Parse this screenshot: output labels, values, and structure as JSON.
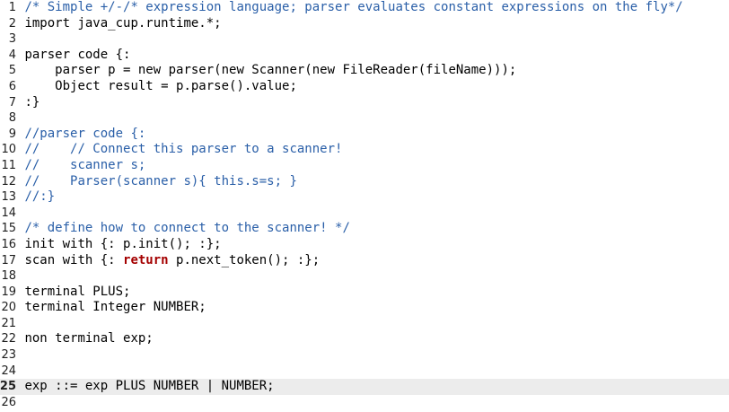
{
  "editor": {
    "current_line": 25,
    "colors": {
      "comment": "#2a5fa8",
      "keyword": "#a40000",
      "current_line_bg": "#ececec"
    },
    "lines": [
      {
        "num": "1",
        "segments": [
          {
            "t": "/* Simple +/-/* expression language; parser evaluates constant expressions on the fly*/",
            "c": "comment"
          }
        ]
      },
      {
        "num": "2",
        "segments": [
          {
            "t": "import java_cup.runtime.*;",
            "c": "plain"
          }
        ]
      },
      {
        "num": "3",
        "segments": []
      },
      {
        "num": "4",
        "segments": [
          {
            "t": "parser code {:",
            "c": "plain"
          }
        ]
      },
      {
        "num": "5",
        "segments": [
          {
            "t": "    parser p = new parser(new Scanner(new FileReader(fileName)));",
            "c": "plain"
          }
        ]
      },
      {
        "num": "6",
        "segments": [
          {
            "t": "    Object result = p.parse().value;",
            "c": "plain"
          }
        ]
      },
      {
        "num": "7",
        "segments": [
          {
            "t": ":}",
            "c": "plain"
          }
        ]
      },
      {
        "num": "8",
        "segments": []
      },
      {
        "num": "9",
        "segments": [
          {
            "t": "//parser code {:",
            "c": "comment"
          }
        ]
      },
      {
        "num": "10",
        "segments": [
          {
            "t": "//    // Connect this parser to a scanner!",
            "c": "comment"
          }
        ]
      },
      {
        "num": "11",
        "segments": [
          {
            "t": "//    scanner s;",
            "c": "comment"
          }
        ]
      },
      {
        "num": "12",
        "segments": [
          {
            "t": "//    Parser(scanner s){ this.s=s; }",
            "c": "comment"
          }
        ]
      },
      {
        "num": "13",
        "segments": [
          {
            "t": "//:}",
            "c": "comment"
          }
        ]
      },
      {
        "num": "14",
        "segments": []
      },
      {
        "num": "15",
        "segments": [
          {
            "t": "/* define how to connect to the scanner! */",
            "c": "comment"
          }
        ]
      },
      {
        "num": "16",
        "segments": [
          {
            "t": "init with {: p.init(); :};",
            "c": "plain"
          }
        ]
      },
      {
        "num": "17",
        "segments": [
          {
            "t": "scan with {: ",
            "c": "plain"
          },
          {
            "t": "return",
            "c": "keyword"
          },
          {
            "t": " p.next_token(); :};",
            "c": "plain"
          }
        ]
      },
      {
        "num": "18",
        "segments": []
      },
      {
        "num": "19",
        "segments": [
          {
            "t": "terminal PLUS;",
            "c": "plain"
          }
        ]
      },
      {
        "num": "20",
        "segments": [
          {
            "t": "terminal Integer NUMBER;",
            "c": "plain"
          }
        ]
      },
      {
        "num": "21",
        "segments": []
      },
      {
        "num": "22",
        "segments": [
          {
            "t": "non terminal exp;",
            "c": "plain"
          }
        ]
      },
      {
        "num": "23",
        "segments": []
      },
      {
        "num": "24",
        "segments": []
      },
      {
        "num": "25",
        "segments": [
          {
            "t": "exp ::= exp PLUS NUMBER | NUMBER;",
            "c": "plain"
          }
        ]
      },
      {
        "num": "26",
        "segments": []
      }
    ]
  }
}
